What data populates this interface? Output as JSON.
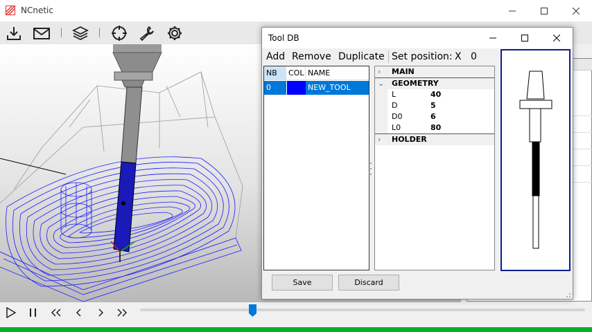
{
  "app": {
    "title": "NCnetic"
  },
  "toolbar": {
    "icons": [
      "download-icon",
      "mail-icon",
      "layers-icon",
      "crosshair-icon",
      "wrench-icon",
      "gear-icon"
    ]
  },
  "playback": {
    "icons": [
      "play-icon",
      "pause-icon",
      "rewind-icon",
      "prev-icon",
      "next-icon",
      "fast-forward-icon"
    ],
    "position": 0.25
  },
  "colors": {
    "selection": "#0078d7",
    "tool_color": "#0000ff",
    "preview_border": "#0a1e8c",
    "status": "#06b025",
    "toolpath": "#1a1aff"
  },
  "dialog": {
    "title": "Tool DB",
    "menu": {
      "add": "Add",
      "remove": "Remove",
      "duplicate": "Duplicate",
      "set_position": "Set position:",
      "x_label": "X",
      "x_value": "0"
    },
    "table": {
      "headers": {
        "nb": "NB",
        "col": "COL",
        "name": "NAME"
      },
      "rows": [
        {
          "nb": "0",
          "name": "NEW_TOOL"
        }
      ]
    },
    "props": {
      "main": "MAIN",
      "geometry": "GEOMETRY",
      "items": [
        {
          "key": "L",
          "value": "40"
        },
        {
          "key": "D",
          "value": "5"
        },
        {
          "key": "D0",
          "value": "6"
        },
        {
          "key": "L0",
          "value": "80"
        }
      ],
      "holder": "HOLDER"
    },
    "buttons": {
      "save": "Save",
      "discard": "Discard"
    }
  }
}
